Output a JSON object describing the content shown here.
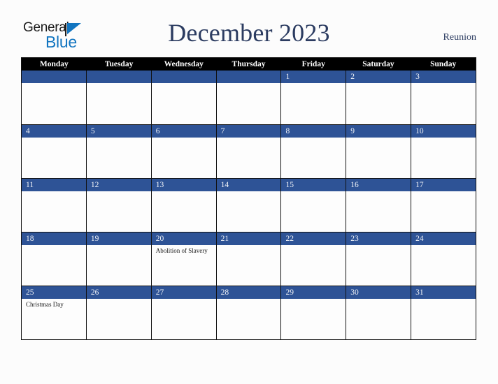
{
  "brand": {
    "line1": "General",
    "line2": "Blue",
    "triangle_color": "#1275c0"
  },
  "header": {
    "title": "December 2023",
    "region": "Reunion",
    "title_color": "#2c3c61"
  },
  "calendar": {
    "weekdays": [
      "Monday",
      "Tuesday",
      "Wednesday",
      "Thursday",
      "Friday",
      "Saturday",
      "Sunday"
    ],
    "header_bg": "#000000",
    "date_bar_color": "#2e5396",
    "cell_bg": "#fdfdfd",
    "weeks": [
      [
        {
          "date": "",
          "events": []
        },
        {
          "date": "",
          "events": []
        },
        {
          "date": "",
          "events": []
        },
        {
          "date": "",
          "events": []
        },
        {
          "date": "1",
          "events": []
        },
        {
          "date": "2",
          "events": []
        },
        {
          "date": "3",
          "events": []
        }
      ],
      [
        {
          "date": "4",
          "events": []
        },
        {
          "date": "5",
          "events": []
        },
        {
          "date": "6",
          "events": []
        },
        {
          "date": "7",
          "events": []
        },
        {
          "date": "8",
          "events": []
        },
        {
          "date": "9",
          "events": []
        },
        {
          "date": "10",
          "events": []
        }
      ],
      [
        {
          "date": "11",
          "events": []
        },
        {
          "date": "12",
          "events": []
        },
        {
          "date": "13",
          "events": []
        },
        {
          "date": "14",
          "events": []
        },
        {
          "date": "15",
          "events": []
        },
        {
          "date": "16",
          "events": []
        },
        {
          "date": "17",
          "events": []
        }
      ],
      [
        {
          "date": "18",
          "events": []
        },
        {
          "date": "19",
          "events": []
        },
        {
          "date": "20",
          "events": [
            "Abolition of Slavery"
          ]
        },
        {
          "date": "21",
          "events": []
        },
        {
          "date": "22",
          "events": []
        },
        {
          "date": "23",
          "events": []
        },
        {
          "date": "24",
          "events": []
        }
      ],
      [
        {
          "date": "25",
          "events": [
            "Christmas Day"
          ]
        },
        {
          "date": "26",
          "events": []
        },
        {
          "date": "27",
          "events": []
        },
        {
          "date": "28",
          "events": []
        },
        {
          "date": "29",
          "events": []
        },
        {
          "date": "30",
          "events": []
        },
        {
          "date": "31",
          "events": []
        }
      ]
    ]
  }
}
